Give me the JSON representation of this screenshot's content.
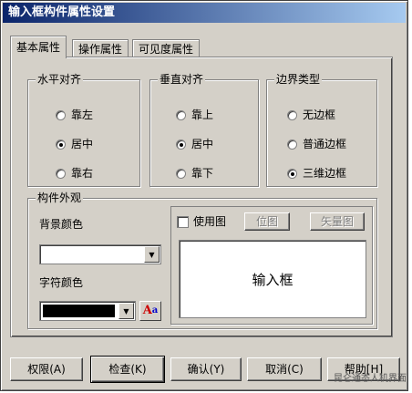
{
  "window": {
    "title": "输入框构件属性设置"
  },
  "tabs": [
    {
      "label": "基本属性",
      "active": true
    },
    {
      "label": "操作属性",
      "active": false
    },
    {
      "label": "可见度属性",
      "active": false
    }
  ],
  "horizontal_align": {
    "title": "水平对齐",
    "options": [
      {
        "label": "靠左",
        "selected": false
      },
      {
        "label": "居中",
        "selected": true
      },
      {
        "label": "靠右",
        "selected": false
      }
    ]
  },
  "vertical_align": {
    "title": "垂直对齐",
    "options": [
      {
        "label": "靠上",
        "selected": false
      },
      {
        "label": "居中",
        "selected": true
      },
      {
        "label": "靠下",
        "selected": false
      }
    ]
  },
  "border_type": {
    "title": "边界类型",
    "options": [
      {
        "label": "无边框",
        "selected": false
      },
      {
        "label": "普通边框",
        "selected": false
      },
      {
        "label": "三维边框",
        "selected": true
      }
    ]
  },
  "appearance": {
    "title": "构件外观",
    "bg_color_label": "背景颜色",
    "bg_color_value": "#ffffff",
    "font_color_label": "字符颜色",
    "font_color_value": "#000000",
    "use_image_label": "使用图",
    "use_image_checked": false,
    "bitmap_button": "位图",
    "vector_button": "矢量图",
    "preview_text": "输入框",
    "font_icon": "font-color-icon"
  },
  "buttons": {
    "permission": "权限(A)",
    "check": "检查(K)",
    "confirm": "确认(Y)",
    "cancel": "取消(C)",
    "help": "帮助[H]"
  },
  "watermark": "昆仑通态人机界面"
}
